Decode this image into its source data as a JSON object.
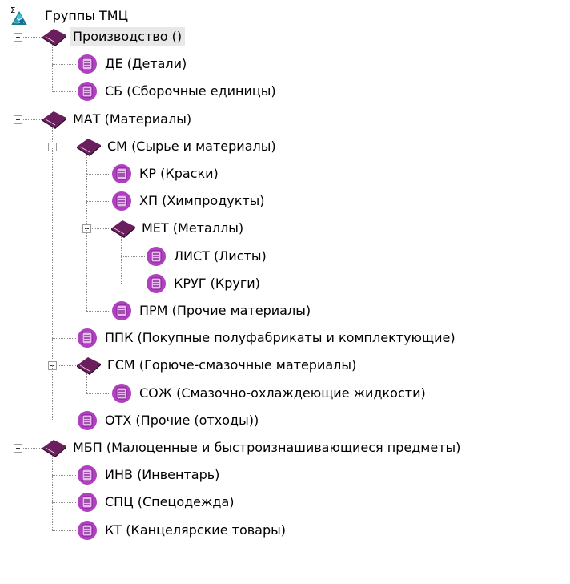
{
  "tree": {
    "root": {
      "label": "Группы ТМЦ",
      "icon": "groups-root-icon"
    },
    "nodes": [
      {
        "id": "proizvodstvo",
        "label": "Производство ()",
        "type": "folder",
        "level": 1,
        "expanded": true,
        "selected": true
      },
      {
        "id": "de",
        "label": "ДЕ (Детали)",
        "type": "item",
        "level": 2
      },
      {
        "id": "sb",
        "label": "СБ (Сборочные единицы)",
        "type": "item",
        "level": 2
      },
      {
        "id": "mat",
        "label": "МАТ (Материалы)",
        "type": "folder",
        "level": 1,
        "expanded": true
      },
      {
        "id": "sm",
        "label": "СМ (Сырье и материалы)",
        "type": "folder",
        "level": 2,
        "expanded": true
      },
      {
        "id": "kr",
        "label": "КР (Краски)",
        "type": "item",
        "level": 3
      },
      {
        "id": "hp",
        "label": "ХП (Химпродукты)",
        "type": "item",
        "level": 3
      },
      {
        "id": "met",
        "label": "МЕТ (Металлы)",
        "type": "folder",
        "level": 3,
        "expanded": true
      },
      {
        "id": "list",
        "label": "ЛИСТ (Листы)",
        "type": "item",
        "level": 4
      },
      {
        "id": "krug",
        "label": "КРУГ (Круги)",
        "type": "item",
        "level": 4
      },
      {
        "id": "prm",
        "label": "ПРМ (Прочие материалы)",
        "type": "item",
        "level": 3
      },
      {
        "id": "ppk",
        "label": "ППК (Покупные полуфабрикаты и комплектующие)",
        "type": "item",
        "level": 2
      },
      {
        "id": "gsm",
        "label": "ГСМ (Горюче-смазочные материалы)",
        "type": "folder",
        "level": 2,
        "expanded": true
      },
      {
        "id": "soz",
        "label": "СОЖ (Смазочно-охлаждеющие жидкости)",
        "type": "item",
        "level": 3
      },
      {
        "id": "oth",
        "label": "ОТХ (Прочие (отходы))",
        "type": "item",
        "level": 2
      },
      {
        "id": "mbp",
        "label": "МБП (Малоценные и быстроизнашивающиеся предметы)",
        "type": "folder",
        "level": 1,
        "expanded": true
      },
      {
        "id": "inv",
        "label": "ИНВ (Инвентарь)",
        "type": "item",
        "level": 2
      },
      {
        "id": "spc",
        "label": "СПЦ (Спецодежда)",
        "type": "item",
        "level": 2
      },
      {
        "id": "kt",
        "label": "КТ (Канцелярские товары)",
        "type": "item",
        "level": 2
      }
    ]
  },
  "colors": {
    "folder_icon": "#6b1e5e",
    "folder_icon_dark": "#3b0a33",
    "item_icon": "#b040c0",
    "item_icon_light": "#e9b8f0",
    "selected_bg": "#e8e8e8",
    "tree_line": "#8a8a8a"
  }
}
